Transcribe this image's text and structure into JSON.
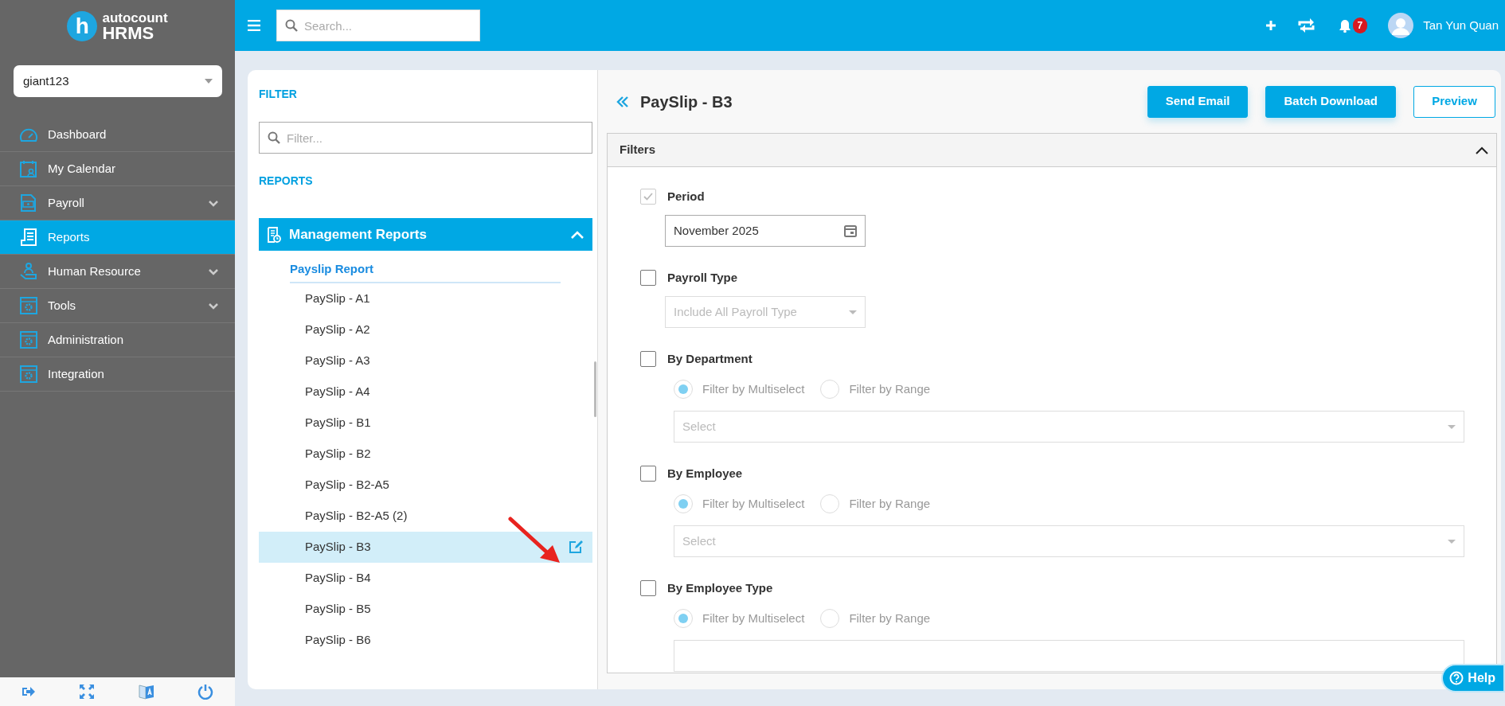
{
  "logo": {
    "letter": "h",
    "brand_top": "autocount",
    "brand_bottom": "HRMS"
  },
  "workspace": {
    "value": "giant123"
  },
  "sidebar": {
    "items": [
      {
        "label": "Dashboard",
        "selected": false,
        "has_submenu": false
      },
      {
        "label": "My Calendar",
        "selected": false,
        "has_submenu": false
      },
      {
        "label": "Payroll",
        "selected": false,
        "has_submenu": true
      },
      {
        "label": "Reports",
        "selected": true,
        "has_submenu": false
      },
      {
        "label": "Human Resource",
        "selected": false,
        "has_submenu": true
      },
      {
        "label": "Tools",
        "selected": false,
        "has_submenu": true
      },
      {
        "label": "Administration",
        "selected": false,
        "has_submenu": false
      },
      {
        "label": "Integration",
        "selected": false,
        "has_submenu": false
      }
    ]
  },
  "topbar": {
    "search_placeholder": "Search...",
    "notification_count": "7",
    "user_name": "Tan Yun Quan"
  },
  "report_list": {
    "filter_heading": "FILTER",
    "filter_placeholder": "Filter...",
    "reports_heading": "REPORTS",
    "group": {
      "title": "Management Reports",
      "expanded": true,
      "section": "Payslip Report",
      "items": [
        {
          "label": "PaySlip - A1",
          "selected": false
        },
        {
          "label": "PaySlip - A2",
          "selected": false
        },
        {
          "label": "PaySlip - A3",
          "selected": false
        },
        {
          "label": "PaySlip - A4",
          "selected": false
        },
        {
          "label": "PaySlip - B1",
          "selected": false
        },
        {
          "label": "PaySlip - B2",
          "selected": false
        },
        {
          "label": "PaySlip - B2-A5",
          "selected": false
        },
        {
          "label": "PaySlip - B2-A5 (2)",
          "selected": false
        },
        {
          "label": "PaySlip - B3",
          "selected": true
        },
        {
          "label": "PaySlip - B4",
          "selected": false
        },
        {
          "label": "PaySlip - B5",
          "selected": false
        },
        {
          "label": "PaySlip - B6",
          "selected": false
        }
      ]
    }
  },
  "report": {
    "title": "PaySlip - B3",
    "buttons": [
      {
        "label": "Send Email",
        "kind": "primary"
      },
      {
        "label": "Batch Download",
        "kind": "primary"
      },
      {
        "label": "Preview",
        "kind": "outline"
      }
    ],
    "filters": {
      "title": "Filters",
      "expanded": true,
      "fields": [
        {
          "kind": "date",
          "label": "Period",
          "checked": true,
          "disabled": true,
          "value": "November 2025"
        },
        {
          "kind": "dropdown",
          "label": "Payroll Type",
          "checked": false,
          "disabled": false,
          "placeholder": "Include All Payroll Type"
        },
        {
          "kind": "multiselect",
          "label": "By Department",
          "checked": false,
          "disabled": false,
          "options": [
            {
              "label": "Filter by Multiselect",
              "selected": true
            },
            {
              "label": "Filter by Range",
              "selected": false
            }
          ],
          "placeholder": "Select"
        },
        {
          "kind": "multiselect",
          "label": "By Employee",
          "checked": false,
          "disabled": false,
          "options": [
            {
              "label": "Filter by Multiselect",
              "selected": true
            },
            {
              "label": "Filter by Range",
              "selected": false
            }
          ],
          "placeholder": "Select"
        },
        {
          "kind": "multiselect",
          "label": "By Employee Type",
          "checked": false,
          "disabled": false,
          "options": [
            {
              "label": "Filter by Multiselect",
              "selected": true
            },
            {
              "label": "Filter by Range",
              "selected": false
            }
          ]
        }
      ]
    }
  },
  "help_button": {
    "label": "Help"
  }
}
